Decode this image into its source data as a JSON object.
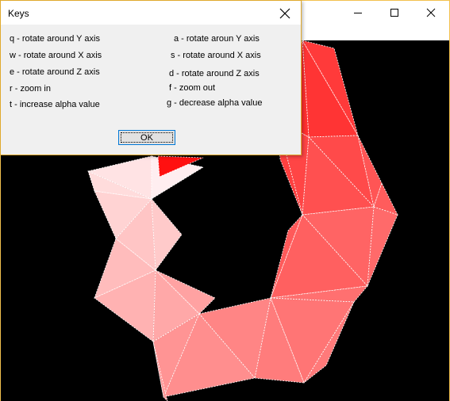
{
  "dialog": {
    "title": "Keys",
    "ok_label": "OK",
    "keys_left": [
      "q - rotate around Y axis",
      "w - rotate around X axis",
      "e - rotate around Z axis",
      "r - zoom in",
      "t - increase alpha value"
    ],
    "keys_right": [
      "a - rotate aroun Y axis",
      "s - rotate around X axis",
      "d - rotate around Z axis",
      "f - zoom out",
      "g - decrease alpha value"
    ]
  },
  "main_window": {
    "caption_buttons": [
      "minimize-icon",
      "maximize-icon",
      "close-icon"
    ],
    "canvas_background": "#000000"
  },
  "colors": {
    "dialog_border": "#e0a92c",
    "window_border": "#f2c14e",
    "ok_focus_border": "#0078d7",
    "mesh_strong": "#ff2a2a",
    "mesh_light": "#ffe4e6"
  }
}
